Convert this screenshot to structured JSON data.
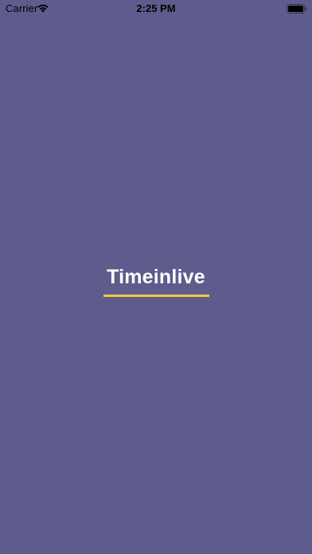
{
  "status_bar": {
    "carrier": "Carrier",
    "time": "2:25 PM",
    "wifi_icon": "wifi-icon",
    "battery_icon": "battery-icon"
  },
  "splash": {
    "brand_name": "Timeinlive",
    "background_color": "#5d5c8d",
    "accent_color": "#f6c83a"
  }
}
